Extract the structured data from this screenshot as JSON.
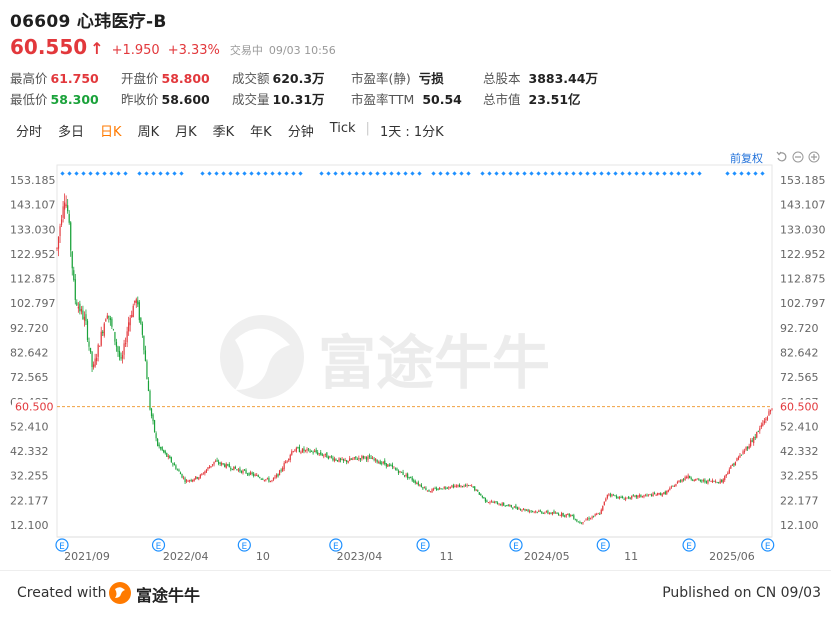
{
  "header": {
    "title": "06609 心玮医疗-B",
    "price": "60.550",
    "change": "+1.950",
    "change_pct": "+3.33%",
    "trade_status": "交易中",
    "trade_time": "09/03 10:56"
  },
  "stats": {
    "high_label": "最高价",
    "high": "61.750",
    "low_label": "最低价",
    "low": "58.300",
    "open_label": "开盘价",
    "open": "58.800",
    "prev_close_label": "昨收价",
    "prev_close": "58.600",
    "turnover_label": "成交额",
    "turnover": "620.3万",
    "volume_label": "成交量",
    "volume": "10.31万",
    "pe_static_label": "市盈率(静)",
    "pe_static": "亏损",
    "pe_ttm_label": "市盈率TTM",
    "pe_ttm": "50.54",
    "shares_label": "总股本",
    "shares": "3883.44万",
    "mktcap_label": "总市值",
    "mktcap": "23.51亿"
  },
  "tabs": [
    {
      "label": "分时"
    },
    {
      "label": "多日"
    },
    {
      "label": "日K"
    },
    {
      "label": "周K"
    },
    {
      "label": "月K"
    },
    {
      "label": "季K"
    },
    {
      "label": "年K"
    },
    {
      "label": "分钟"
    },
    {
      "label": "Tick"
    },
    {
      "label": "1天 : 1分K"
    }
  ],
  "active_tab": 2,
  "adjust_label": "前复权",
  "watermark": "富途牛牛",
  "footer": {
    "created": "Created with",
    "brand": "富途牛牛",
    "published": "Published on CN 09/03"
  },
  "colors": {
    "up": "#e2383c",
    "down": "#1aa23a",
    "accent": "#ff7a00",
    "marker": "#1e90ff"
  },
  "chart_data": {
    "type": "candlestick",
    "y_ticks": [
      "153.185",
      "143.107",
      "133.030",
      "122.952",
      "112.875",
      "102.797",
      "92.720",
      "82.642",
      "72.565",
      "62.487",
      "52.410",
      "42.332",
      "32.255",
      "22.177",
      "12.100"
    ],
    "ylim": [
      12.1,
      153.185
    ],
    "current_price_label": "60.500",
    "current_price": 60.5,
    "x_ticks": [
      "2021/09",
      "2022/04",
      "10",
      "2023/04",
      "11",
      "2024/05",
      "11",
      "2025/06"
    ],
    "x_tick_pos": [
      0.042,
      0.18,
      0.288,
      0.423,
      0.545,
      0.685,
      0.803,
      0.944
    ],
    "event_label": "E",
    "event_pos": [
      0.0,
      0.135,
      0.255,
      0.383,
      0.505,
      0.635,
      0.757,
      0.877,
      0.987
    ],
    "price_path": [
      [
        0.0,
        125
      ],
      [
        0.01,
        148
      ],
      [
        0.015,
        140
      ],
      [
        0.025,
        105
      ],
      [
        0.04,
        95
      ],
      [
        0.05,
        75
      ],
      [
        0.07,
        100
      ],
      [
        0.09,
        78
      ],
      [
        0.1,
        95
      ],
      [
        0.11,
        105
      ],
      [
        0.12,
        90
      ],
      [
        0.13,
        60
      ],
      [
        0.14,
        45
      ],
      [
        0.16,
        38
      ],
      [
        0.18,
        30
      ],
      [
        0.2,
        32
      ],
      [
        0.22,
        38
      ],
      [
        0.25,
        35
      ],
      [
        0.28,
        32
      ],
      [
        0.3,
        30
      ],
      [
        0.31,
        33
      ],
      [
        0.32,
        38
      ],
      [
        0.33,
        43
      ],
      [
        0.36,
        42
      ],
      [
        0.4,
        38
      ],
      [
        0.43,
        40
      ],
      [
        0.46,
        37
      ],
      [
        0.49,
        32
      ],
      [
        0.52,
        26
      ],
      [
        0.55,
        28
      ],
      [
        0.58,
        28
      ],
      [
        0.6,
        22
      ],
      [
        0.63,
        20
      ],
      [
        0.66,
        18
      ],
      [
        0.69,
        17
      ],
      [
        0.72,
        16
      ],
      [
        0.73,
        13
      ],
      [
        0.76,
        17
      ],
      [
        0.77,
        25
      ],
      [
        0.79,
        23
      ],
      [
        0.82,
        24
      ],
      [
        0.85,
        25
      ],
      [
        0.87,
        30
      ],
      [
        0.88,
        32
      ],
      [
        0.9,
        30
      ],
      [
        0.93,
        30
      ],
      [
        0.94,
        35
      ],
      [
        0.96,
        42
      ],
      [
        0.98,
        50
      ],
      [
        0.99,
        55
      ],
      [
        1.0,
        60
      ]
    ]
  }
}
